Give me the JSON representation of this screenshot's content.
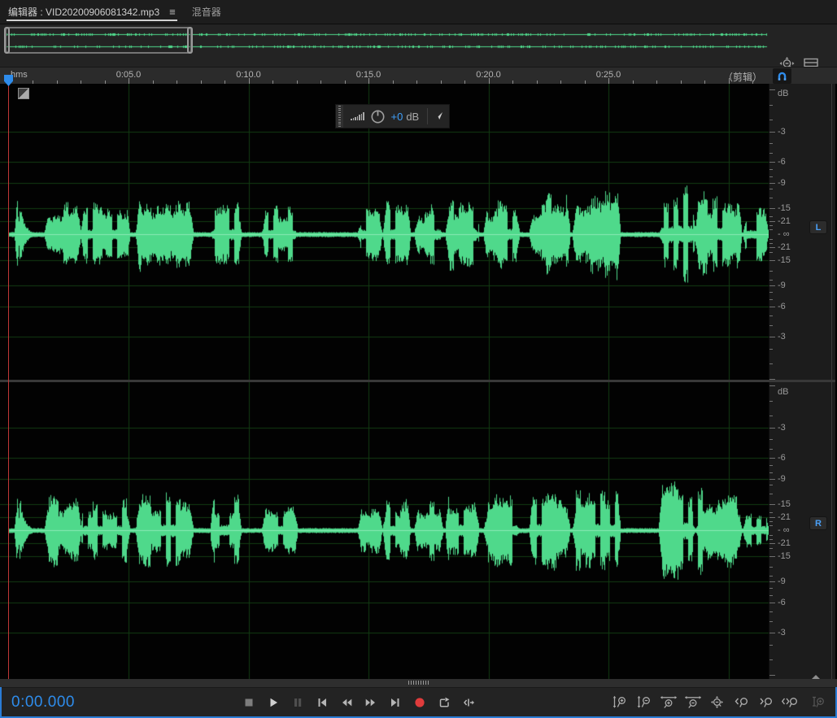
{
  "window_tabs": {
    "editor": {
      "label": "编辑器 : VID20200906081342.mp3"
    },
    "editor_menu_icon": "panel-menu",
    "mixer": {
      "label": "混音器"
    }
  },
  "overview_bar": {
    "icons": [
      "zoom-out-full",
      "panel-list"
    ]
  },
  "ruler": {
    "unit_label": "hms",
    "time_labels": [
      {
        "seconds": 5,
        "text": "0:05.0"
      },
      {
        "seconds": 10,
        "text": "0:10.0"
      },
      {
        "seconds": 15,
        "text": "0:15.0"
      },
      {
        "seconds": 20,
        "text": "0:20.0"
      },
      {
        "seconds": 25,
        "text": "0:25.0"
      }
    ],
    "right_label": "（剪辑）",
    "snap_icon": "magnet"
  },
  "hud": {
    "icons": [
      "drag-grip",
      "volume-bars",
      "gain-knob"
    ],
    "gain_value": "+0",
    "gain_unit": "dB",
    "pin_icon": "pin"
  },
  "db_scale": {
    "unit_label": "dB",
    "labels": [
      {
        "db": 3,
        "text": "-3"
      },
      {
        "db": 6,
        "text": "-6"
      },
      {
        "db": 9,
        "text": "-9"
      },
      {
        "db": 15,
        "text": "-15"
      },
      {
        "db": 21,
        "text": "-21"
      }
    ],
    "center_label": "- ∞",
    "tick_dbs": [
      0,
      1,
      2,
      3,
      4,
      5,
      6,
      7,
      8,
      9,
      10,
      12,
      15,
      18,
      21,
      24,
      30
    ]
  },
  "channels": [
    {
      "badge": "L"
    },
    {
      "badge": "R"
    }
  ],
  "transport": {
    "time_display": "0:00.000",
    "buttons": [
      "stop",
      "play",
      "pause",
      "skip-to-start",
      "rewind",
      "fast-forward",
      "skip-to-end",
      "record",
      "loop-playback",
      "move-playhead"
    ]
  },
  "zoom_toolbar": {
    "buttons": [
      "zoom-in-vertical",
      "zoom-out-vertical",
      "zoom-in-horizontal",
      "zoom-out-horizontal",
      "zoom-out-full",
      "zoom-to-in-point",
      "zoom-to-out-point",
      "zoom-to-selection",
      "zoom-to-frequency-disabled"
    ]
  },
  "colors": {
    "accent_blue": "#2e8ceb",
    "waveform_green": "#4fd98b",
    "waveform_centerline": "#8ce9b6",
    "grid_green": "#123c12",
    "playhead_red": "#c03737",
    "record_red": "#e03c3c",
    "time_display_blue": "#2e8ceb",
    "badge_blue": "#4aa0f7"
  },
  "chart_data": {
    "type": "area",
    "title": "Stereo waveform of VID20200906081342.mp3",
    "x_axis": {
      "unit": "hms",
      "visible_range_s": [
        0,
        31.7
      ],
      "label_interval_s": 5,
      "minor_tick_s": 1
    },
    "y_axis": {
      "unit": "dB",
      "labels": [
        "-3",
        "-6",
        "-9",
        "-15",
        "-21",
        "- ∞"
      ],
      "scale": "linear-amplitude-mirrored"
    },
    "channels": [
      "L",
      "R"
    ],
    "baseline_amplitude": 0.012,
    "bursts_s": [
      [
        0.25,
        0.45,
        0.26
      ],
      [
        1.5,
        3.0,
        0.17
      ],
      [
        3.0,
        5.05,
        0.15
      ],
      [
        5.3,
        7.7,
        0.19
      ],
      [
        8.4,
        9.7,
        0.17
      ],
      [
        10.55,
        12.05,
        0.14
      ],
      [
        14.55,
        15.55,
        0.15
      ],
      [
        15.6,
        16.75,
        0.17
      ],
      [
        16.9,
        18.1,
        0.16
      ],
      [
        18.2,
        19.6,
        0.19
      ],
      [
        19.8,
        21.3,
        0.17
      ],
      [
        21.7,
        23.4,
        0.19
      ],
      [
        23.5,
        25.5,
        0.21
      ],
      [
        27.1,
        28.6,
        0.27
      ],
      [
        28.6,
        30.55,
        0.21
      ],
      [
        30.6,
        31.65,
        0.13
      ]
    ],
    "spike_tail_s": [
      0.45,
      1.6,
      0.2
    ]
  }
}
